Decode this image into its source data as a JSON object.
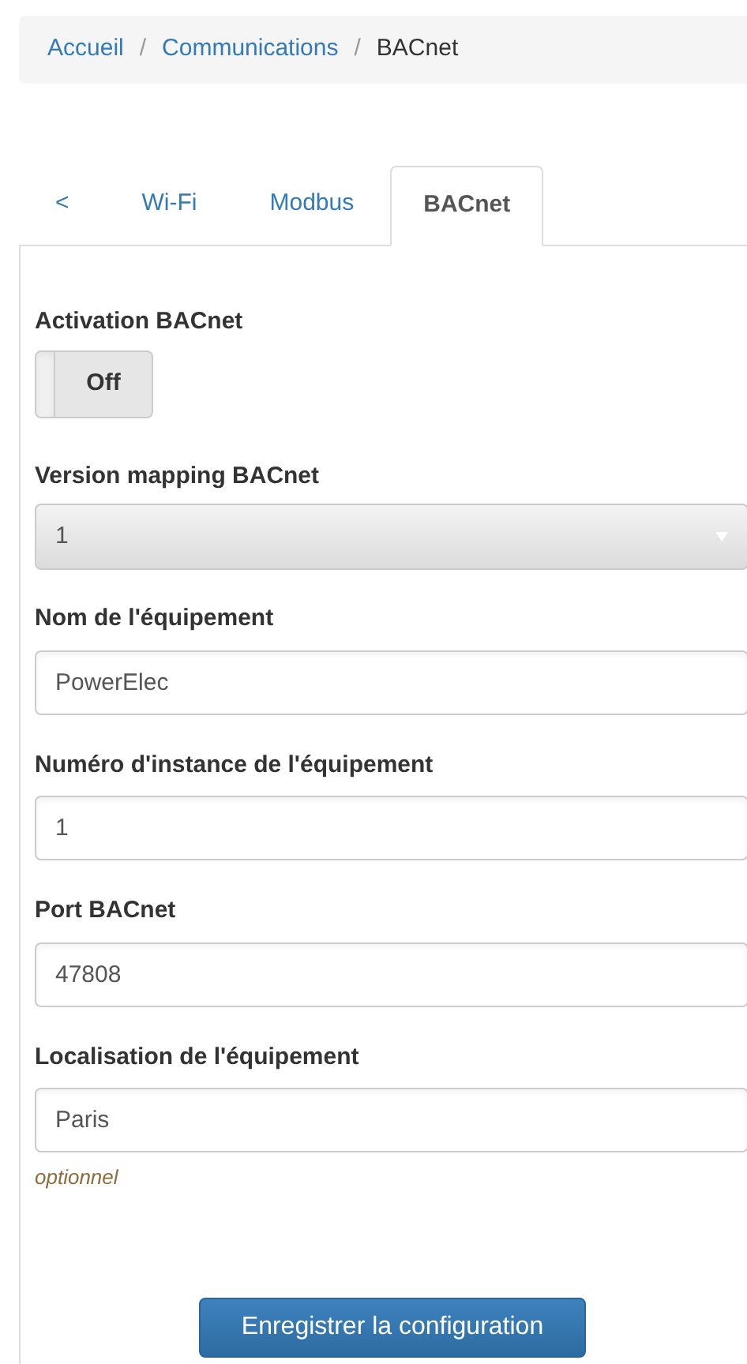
{
  "breadcrumb": [
    {
      "label": "Accueil",
      "link": true
    },
    {
      "label": "Communications",
      "link": true,
      "separator": "/"
    },
    {
      "label": "BACnet",
      "link": false,
      "separator": "/"
    }
  ],
  "tabs": [
    {
      "label": "<",
      "selected": false
    },
    {
      "label": "Wi-Fi",
      "selected": false
    },
    {
      "label": "Modbus",
      "selected": false
    },
    {
      "label": "BACnet",
      "selected": true
    }
  ],
  "form": {
    "toggle": {
      "label": "Activation BACnet",
      "on": false,
      "state_text": "Off"
    },
    "select": {
      "label": "Version mapping BACnet",
      "value": "1"
    },
    "fields": [
      {
        "label": "Nom de l'équipement",
        "value": "PowerElec"
      },
      {
        "label": "Numéro d'instance de l'équipement",
        "value": "1"
      },
      {
        "label": "Port BACnet",
        "value": "47808"
      },
      {
        "label": "Localisation de l'équipement",
        "value": "Paris",
        "help": "optionnel"
      }
    ],
    "submit": "Enregistrer la configuration"
  }
}
